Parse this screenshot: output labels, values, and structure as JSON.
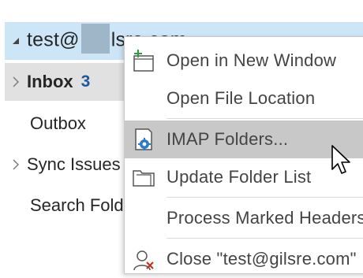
{
  "folder_tree": {
    "account": {
      "label_prefix": "test@",
      "label_suffix": "lsre.com",
      "expanded": true
    },
    "folders": [
      {
        "label": "Inbox",
        "count": "3",
        "bold": true,
        "has_children": true,
        "selected": true
      },
      {
        "label": "Outbox",
        "has_children": false
      },
      {
        "label": "Sync Issues",
        "has_children": true
      },
      {
        "label": "Search Folders",
        "has_children": false
      }
    ]
  },
  "context_menu": {
    "items": [
      {
        "label": "Open in New Window",
        "icon": "new-window-icon"
      },
      {
        "label": "Open File Location",
        "icon": ""
      },
      {
        "label": "IMAP Folders...",
        "icon": "imap-folders-icon",
        "highlighted": true
      },
      {
        "label": "Update Folder List",
        "icon": "folder-list-icon"
      },
      {
        "label": "Process Marked Headers",
        "icon": ""
      },
      {
        "label": "Close \"test@gilsre.com\"",
        "icon": "close-account-icon"
      }
    ]
  },
  "colors": {
    "account_selected_bg": "#cde6f7",
    "inbox_selected_bg": "#e1e1e1",
    "menu_highlight_bg": "#c8c8c8",
    "unread_count": "#1b5a9e"
  }
}
